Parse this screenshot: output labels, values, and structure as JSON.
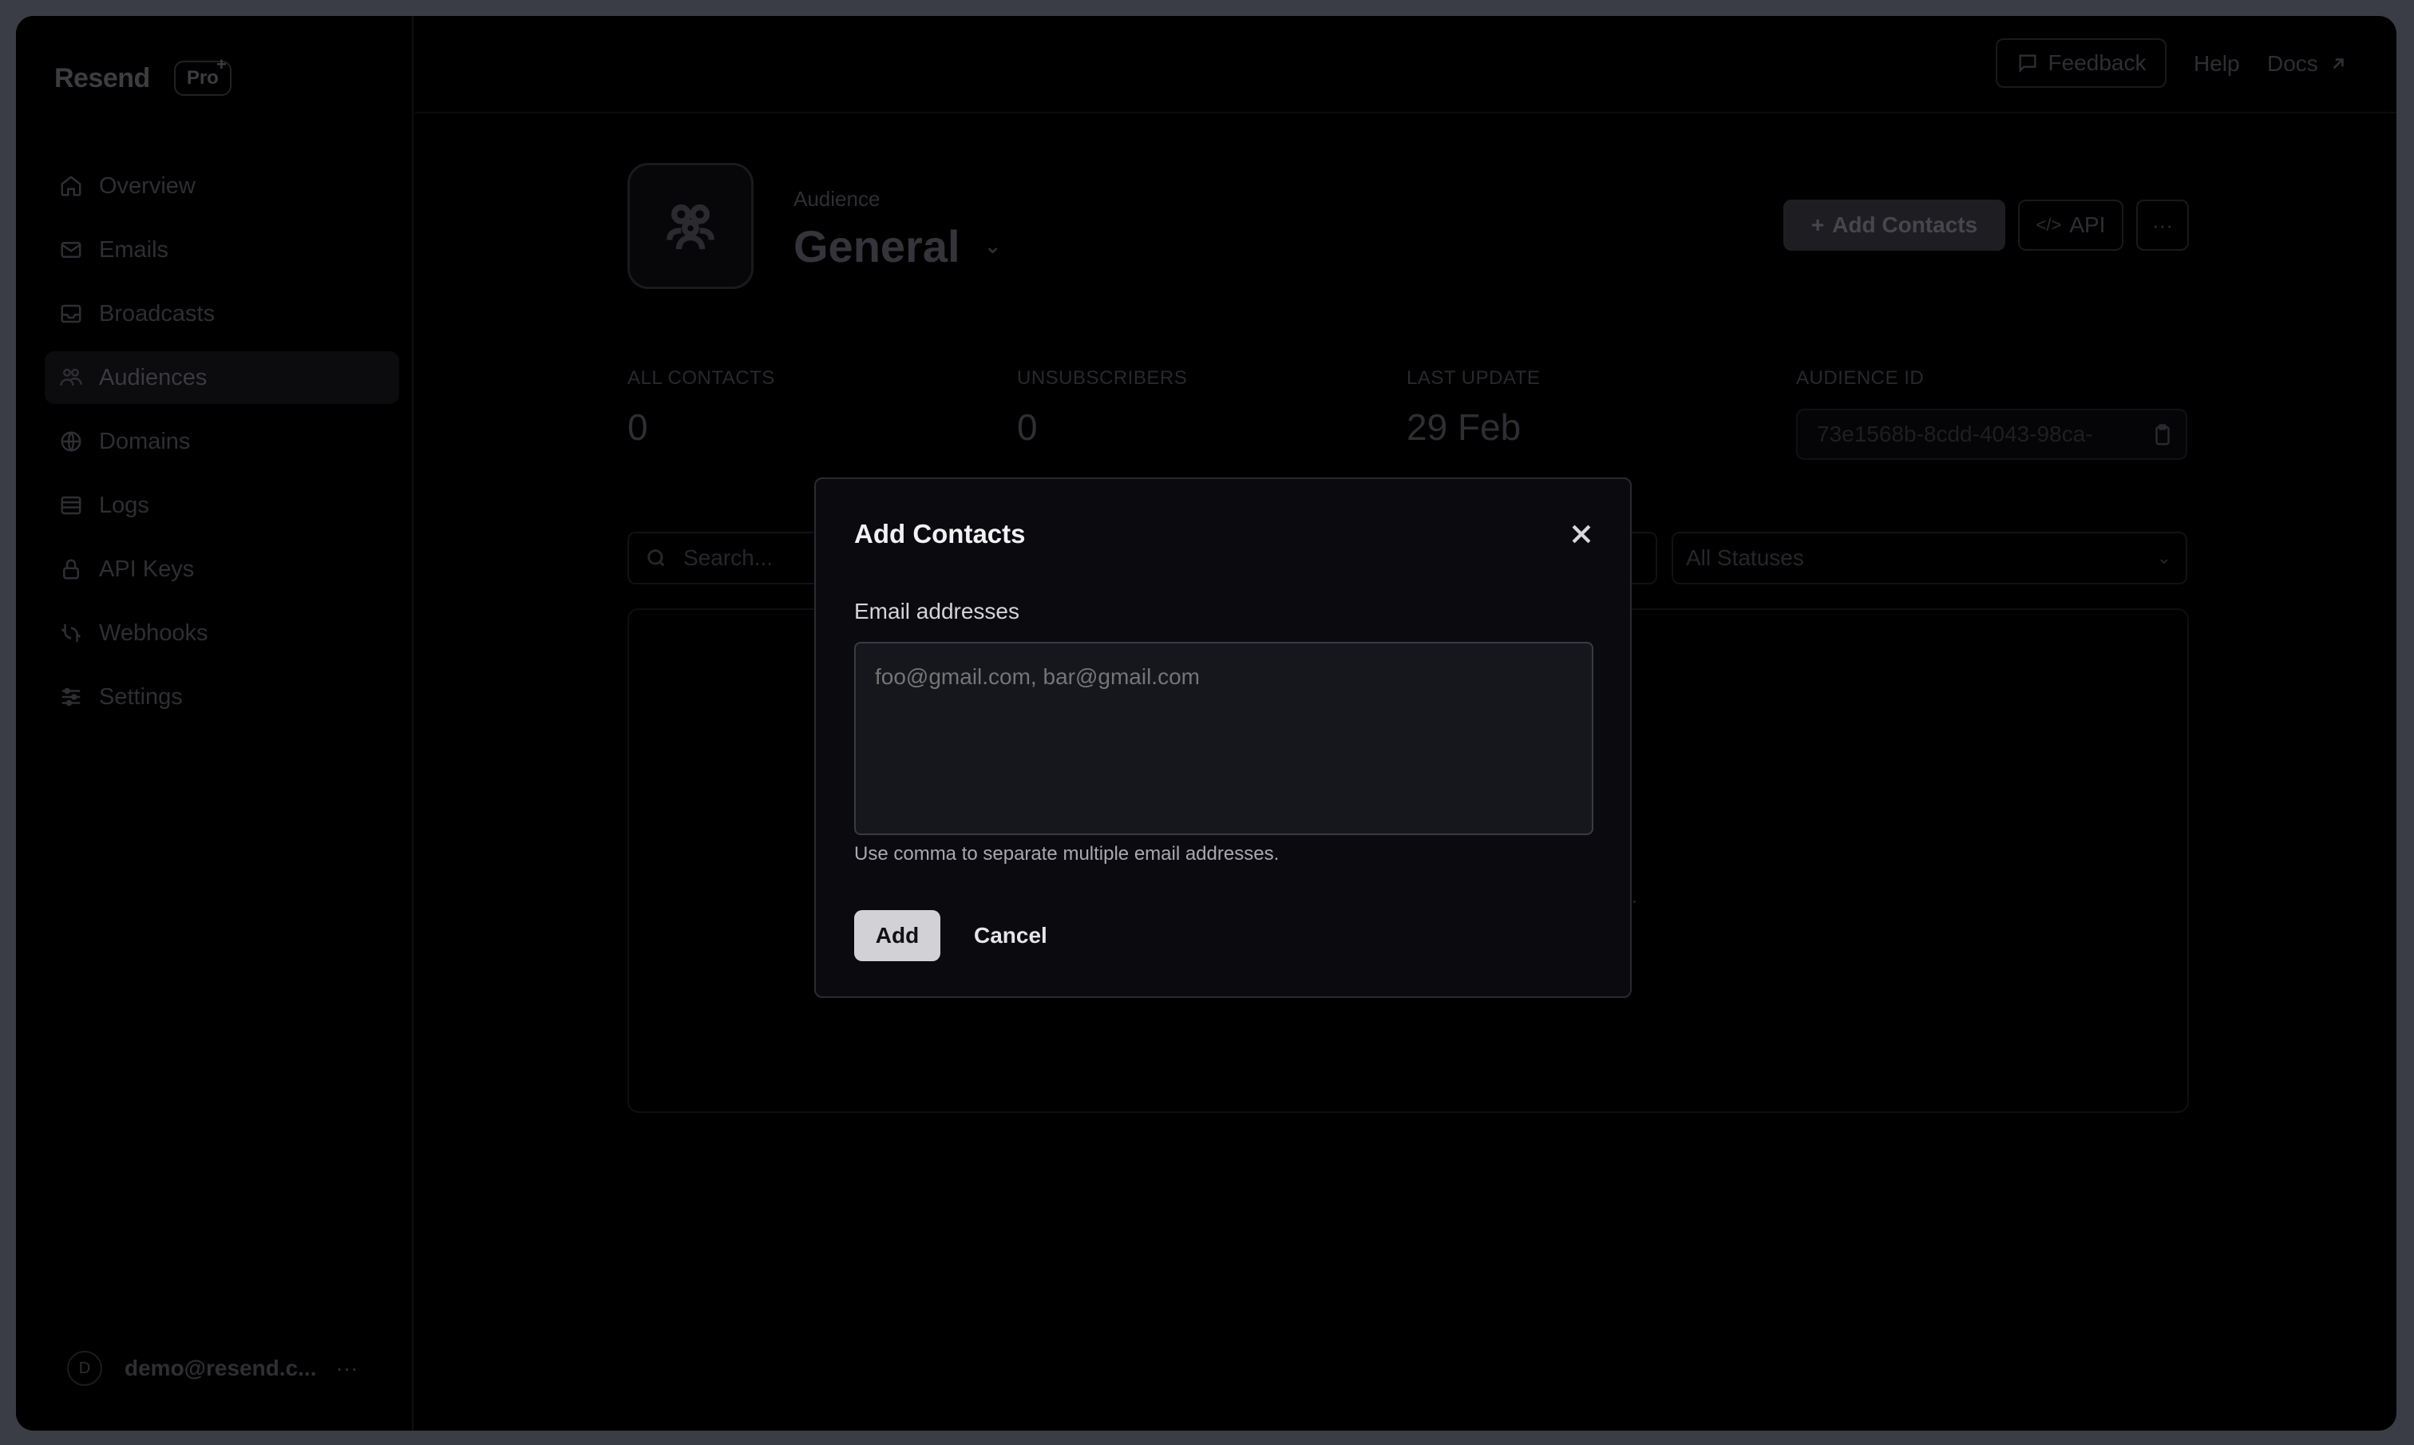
{
  "brand": {
    "name": "Resend",
    "plan": "Pro",
    "plan_mark": "+"
  },
  "sidebar": {
    "items": [
      {
        "label": "Overview",
        "icon": "home-icon"
      },
      {
        "label": "Emails",
        "icon": "mail-icon"
      },
      {
        "label": "Broadcasts",
        "icon": "inbox-icon"
      },
      {
        "label": "Audiences",
        "icon": "users-icon",
        "active": true
      },
      {
        "label": "Domains",
        "icon": "globe-icon"
      },
      {
        "label": "Logs",
        "icon": "list-icon"
      },
      {
        "label": "API Keys",
        "icon": "lock-icon"
      },
      {
        "label": "Webhooks",
        "icon": "webhook-icon"
      },
      {
        "label": "Settings",
        "icon": "sliders-icon"
      }
    ],
    "user": {
      "avatar_initial": "D",
      "email": "demo@resend.c...",
      "more": "···"
    }
  },
  "topbar": {
    "feedback": "Feedback",
    "help": "Help",
    "docs": "Docs"
  },
  "audience": {
    "label": "Audience",
    "name": "General",
    "add_contacts": "Add Contacts",
    "api": "API",
    "more": "···"
  },
  "stats": {
    "all_contacts_label": "ALL CONTACTS",
    "all_contacts_value": "0",
    "unsubscribers_label": "UNSUBSCRIBERS",
    "unsubscribers_value": "0",
    "last_update_label": "LAST UPDATE",
    "last_update_value": "29 Feb",
    "audience_id_label": "AUDIENCE ID",
    "audience_id_value": "73e1568b-8cdd-4043-98ca-"
  },
  "filters": {
    "search_placeholder": "Search...",
    "status_value": "All Statuses"
  },
  "empty_hint": "e.",
  "modal": {
    "title": "Add Contacts",
    "field_label": "Email addresses",
    "textarea_placeholder": "foo@gmail.com, bar@gmail.com",
    "help": "Use comma to separate multiple email addresses.",
    "add": "Add",
    "cancel": "Cancel"
  },
  "colors": {
    "modal_bg": "#0b0b0f",
    "primary_button": "#d2d2d6",
    "frame_bg": "#000000"
  }
}
